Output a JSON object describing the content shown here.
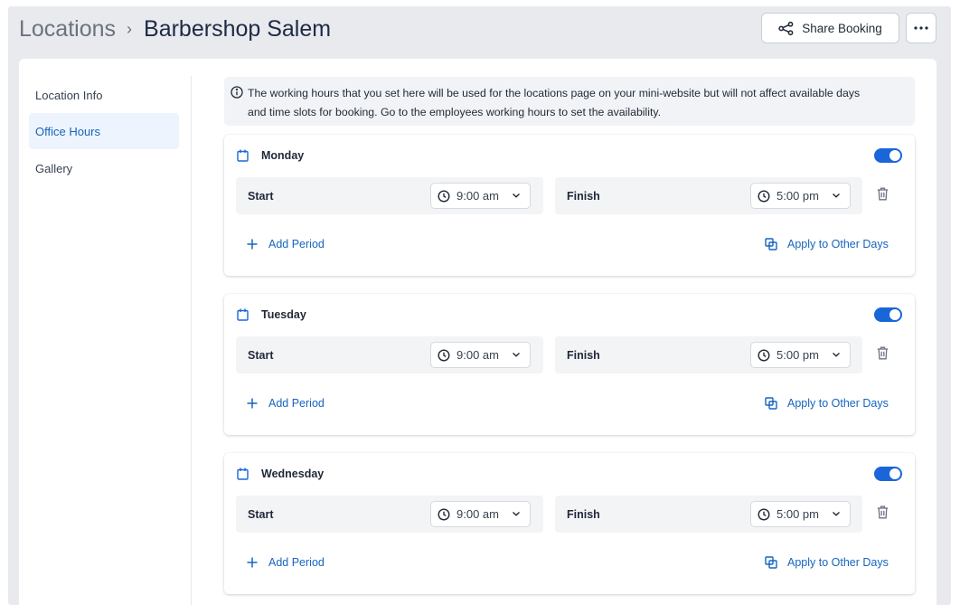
{
  "header": {
    "breadcrumb_root": "Locations",
    "breadcrumb_separator": "›",
    "breadcrumb_current": "Barbershop Salem",
    "share_label": "Share Booking"
  },
  "sidebar": {
    "items": [
      {
        "label": "Location Info",
        "active": false
      },
      {
        "label": "Office Hours",
        "active": true
      },
      {
        "label": "Gallery",
        "active": false
      }
    ]
  },
  "info_text_line1": "The working hours that you set here will be used for the locations page on your mini-website but will not affect available days",
  "info_text_line2": "and time slots for booking. Go to the employees working hours to set the availability.",
  "days": [
    {
      "name": "Monday",
      "enabled": true,
      "start_label": "Start",
      "start_value": "9:00 am",
      "finish_label": "Finish",
      "finish_value": "5:00 pm",
      "add_period": "Add Period",
      "apply_other": "Apply to Other Days"
    },
    {
      "name": "Tuesday",
      "enabled": true,
      "start_label": "Start",
      "start_value": "9:00 am",
      "finish_label": "Finish",
      "finish_value": "5:00 pm",
      "add_period": "Add Period",
      "apply_other": "Apply to Other Days"
    },
    {
      "name": "Wednesday",
      "enabled": true,
      "start_label": "Start",
      "start_value": "9:00 am",
      "finish_label": "Finish",
      "finish_value": "5:00 pm",
      "add_period": "Add Period",
      "apply_other": "Apply to Other Days"
    }
  ],
  "icons": {
    "share": "share-icon",
    "more": "more-horizontal-icon",
    "info": "info-circle-icon",
    "calendar": "calendar-icon",
    "clock": "clock-icon",
    "chevron": "chevron-down-icon",
    "trash": "trash-icon",
    "plus": "plus-icon",
    "copy": "copy-icon"
  },
  "colors": {
    "accent": "#1a66d9",
    "link": "#1665c0",
    "app_background": "#e8eaee",
    "active_nav_bg": "#edf4fd"
  }
}
